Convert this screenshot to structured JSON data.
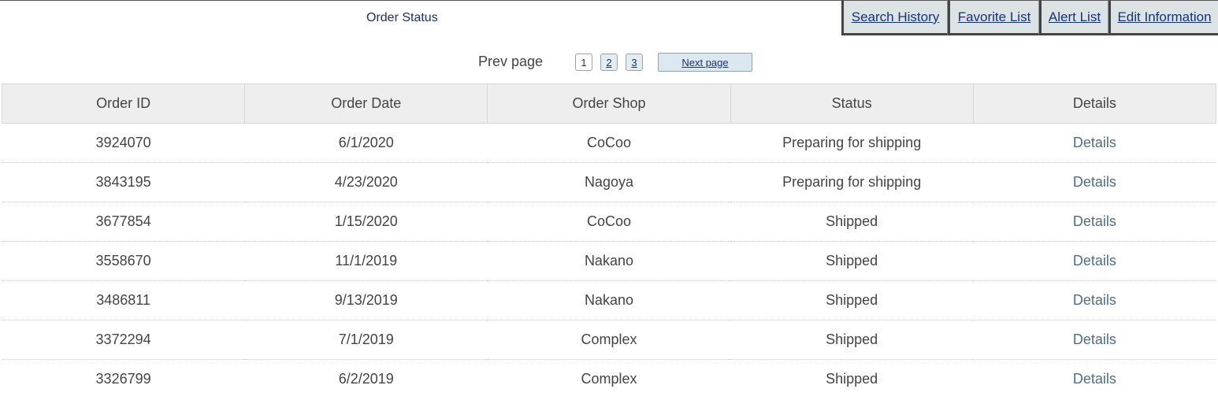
{
  "header": {
    "title": "Order Status"
  },
  "nav": {
    "tabs": [
      {
        "label": "Search History"
      },
      {
        "label": "Favorite List"
      },
      {
        "label": "Alert List"
      },
      {
        "label": "Edit Information"
      }
    ]
  },
  "pagination": {
    "prev_label": "Prev page",
    "pages": [
      "1",
      "2",
      "3"
    ],
    "current_page": "1",
    "next_label": "Next page"
  },
  "table": {
    "columns": [
      "Order ID",
      "Order Date",
      "Order Shop",
      "Status",
      "Details"
    ],
    "rows": [
      {
        "order_id": "3924070",
        "date": "6/1/2020",
        "shop": "CoCoo",
        "status": "Preparing for shipping",
        "details": "Details"
      },
      {
        "order_id": "3843195",
        "date": "4/23/2020",
        "shop": "Nagoya",
        "status": "Preparing for shipping",
        "details": "Details"
      },
      {
        "order_id": "3677854",
        "date": "1/15/2020",
        "shop": "CoCoo",
        "status": "Shipped",
        "details": "Details"
      },
      {
        "order_id": "3558670",
        "date": "11/1/2019",
        "shop": "Nakano",
        "status": "Shipped",
        "details": "Details"
      },
      {
        "order_id": "3486811",
        "date": "9/13/2019",
        "shop": "Nakano",
        "status": "Shipped",
        "details": "Details"
      },
      {
        "order_id": "3372294",
        "date": "7/1/2019",
        "shop": "Complex",
        "status": "Shipped",
        "details": "Details"
      },
      {
        "order_id": "3326799",
        "date": "6/2/2019",
        "shop": "Complex",
        "status": "Shipped",
        "details": "Details"
      }
    ]
  },
  "colors": {
    "link": "#13337a",
    "details_link": "#4c6e8c",
    "tab_bg": "#dde3e5",
    "header_bg": "#eeeeee"
  }
}
